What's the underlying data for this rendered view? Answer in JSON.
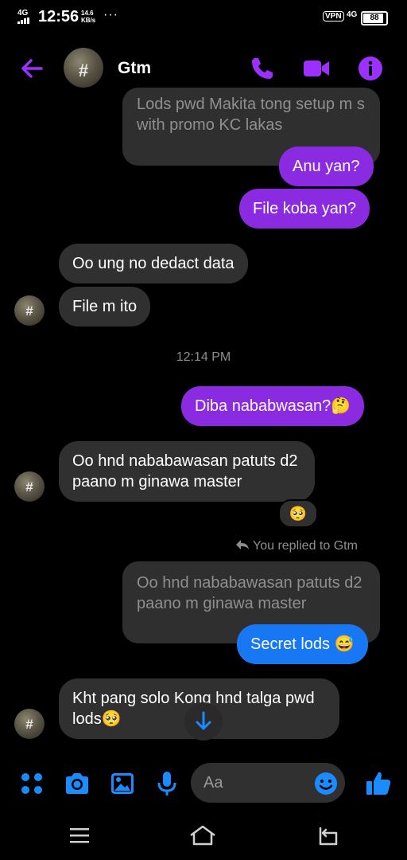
{
  "status_bar": {
    "signal_text": "4G",
    "time": "12:56",
    "speed_value": "14.6",
    "speed_unit": "KB/s",
    "more": "···",
    "vpn": "VPN",
    "network": "4G",
    "battery": "88"
  },
  "header": {
    "contact_name": "Gtm",
    "avatar_glyph": "#"
  },
  "messages": {
    "quoted_top": "Lods pwd Makita tong setup m s with promo KC lakas",
    "out_1": "Anu yan?",
    "out_2": "File koba yan?",
    "in_1": "Oo ung no dedact  data",
    "in_2": "File m ito",
    "timestamp": "12:14 PM",
    "out_3": "Diba nababwasan?🤔",
    "in_3": "Oo hnd nababawasan patuts d2 paano m ginawa master",
    "reaction": "🥺",
    "replied_note": "You replied to Gtm",
    "quoted_reply": "Oo hnd nababawasan patuts d2 paano m ginawa master",
    "out_4": "Secret lods 😅",
    "in_4": "Kht pang solo Kong hnd talga pwd lods🥺"
  },
  "composer": {
    "placeholder": "Aa"
  },
  "colors": {
    "accent_purple": "#9b30ff",
    "bubble_purple": "#8a2be2",
    "bubble_blue": "#1877f2",
    "icon_blue": "#1a8cff",
    "incoming_bubble": "#303030"
  }
}
